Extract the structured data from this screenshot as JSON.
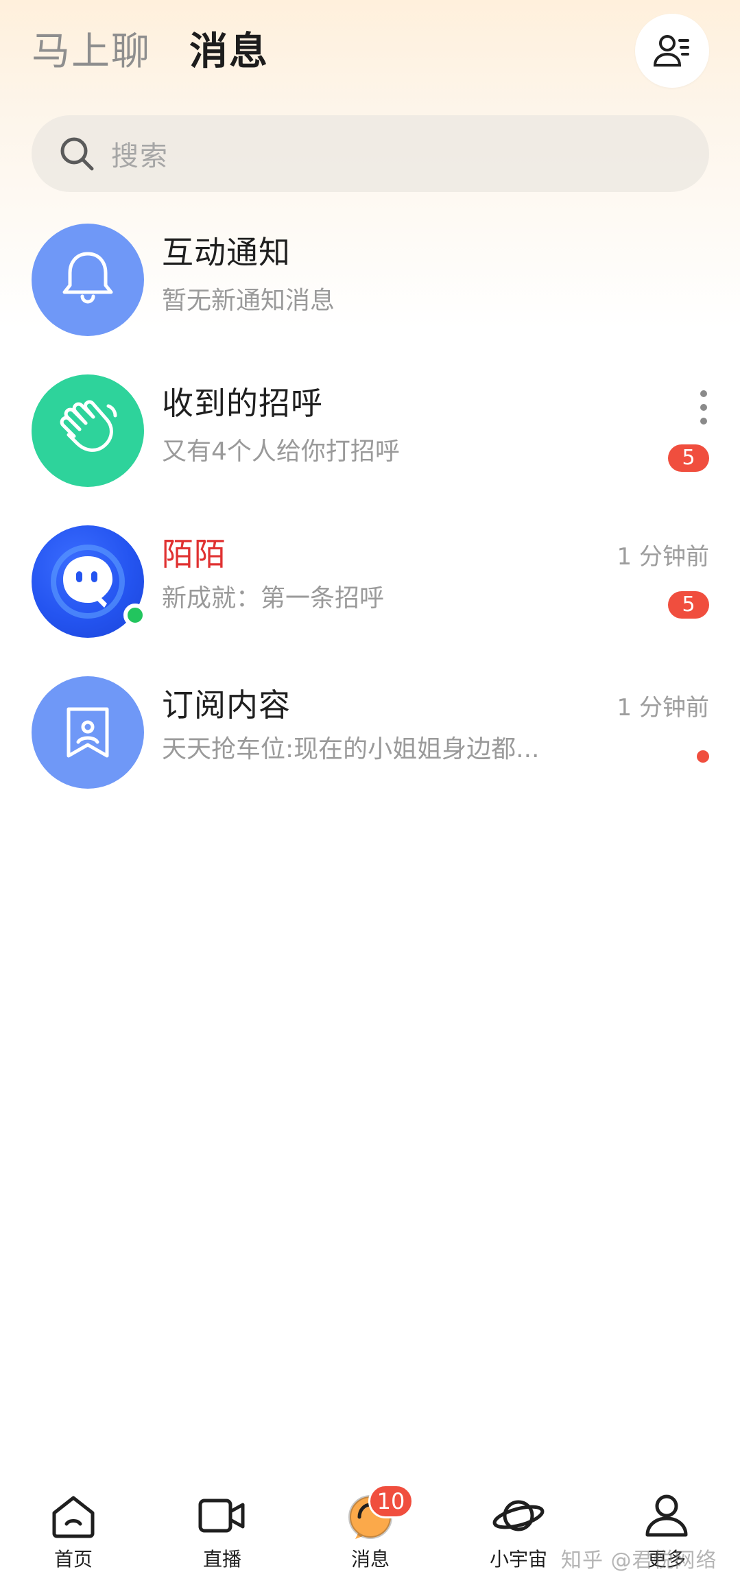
{
  "header": {
    "tab_chat": "马上聊",
    "tab_messages": "消息",
    "contacts_icon": "contacts-icon"
  },
  "search": {
    "placeholder": "搜索"
  },
  "conversations": [
    {
      "title": "互动通知",
      "subtitle": "暂无新通知消息",
      "icon": "bell-icon",
      "avatar_color": "#6f98f7"
    },
    {
      "title": "收到的招呼",
      "subtitle": "又有4个人给你打招呼",
      "badge": "5",
      "icon": "waving-hand-icon",
      "avatar_color": "#2ed39b"
    },
    {
      "title": "陌陌",
      "subtitle": "新成就：第一条招呼",
      "time": "1 分钟前",
      "badge": "5",
      "icon": "momo-logo-icon",
      "title_color": "#e03131"
    },
    {
      "title": "订阅内容",
      "subtitle": "天天抢车位:现在的小姐姐身边都...",
      "time": "1 分钟前",
      "icon": "bookmark-icon",
      "avatar_color": "#6f98f7"
    }
  ],
  "bottom_nav": {
    "items": [
      {
        "label": "首页",
        "icon": "home-icon"
      },
      {
        "label": "直播",
        "icon": "video-camera-icon"
      },
      {
        "label": "消息",
        "icon": "chat-bubble-icon",
        "badge": "10"
      },
      {
        "label": "小宇宙",
        "icon": "planet-icon"
      },
      {
        "label": "更多",
        "icon": "person-icon"
      }
    ]
  },
  "watermark": "知乎 @君悦网络",
  "colors": {
    "accent_orange": "#fba94a",
    "badge_red": "#f04e3e",
    "online_green": "#22c55e"
  }
}
